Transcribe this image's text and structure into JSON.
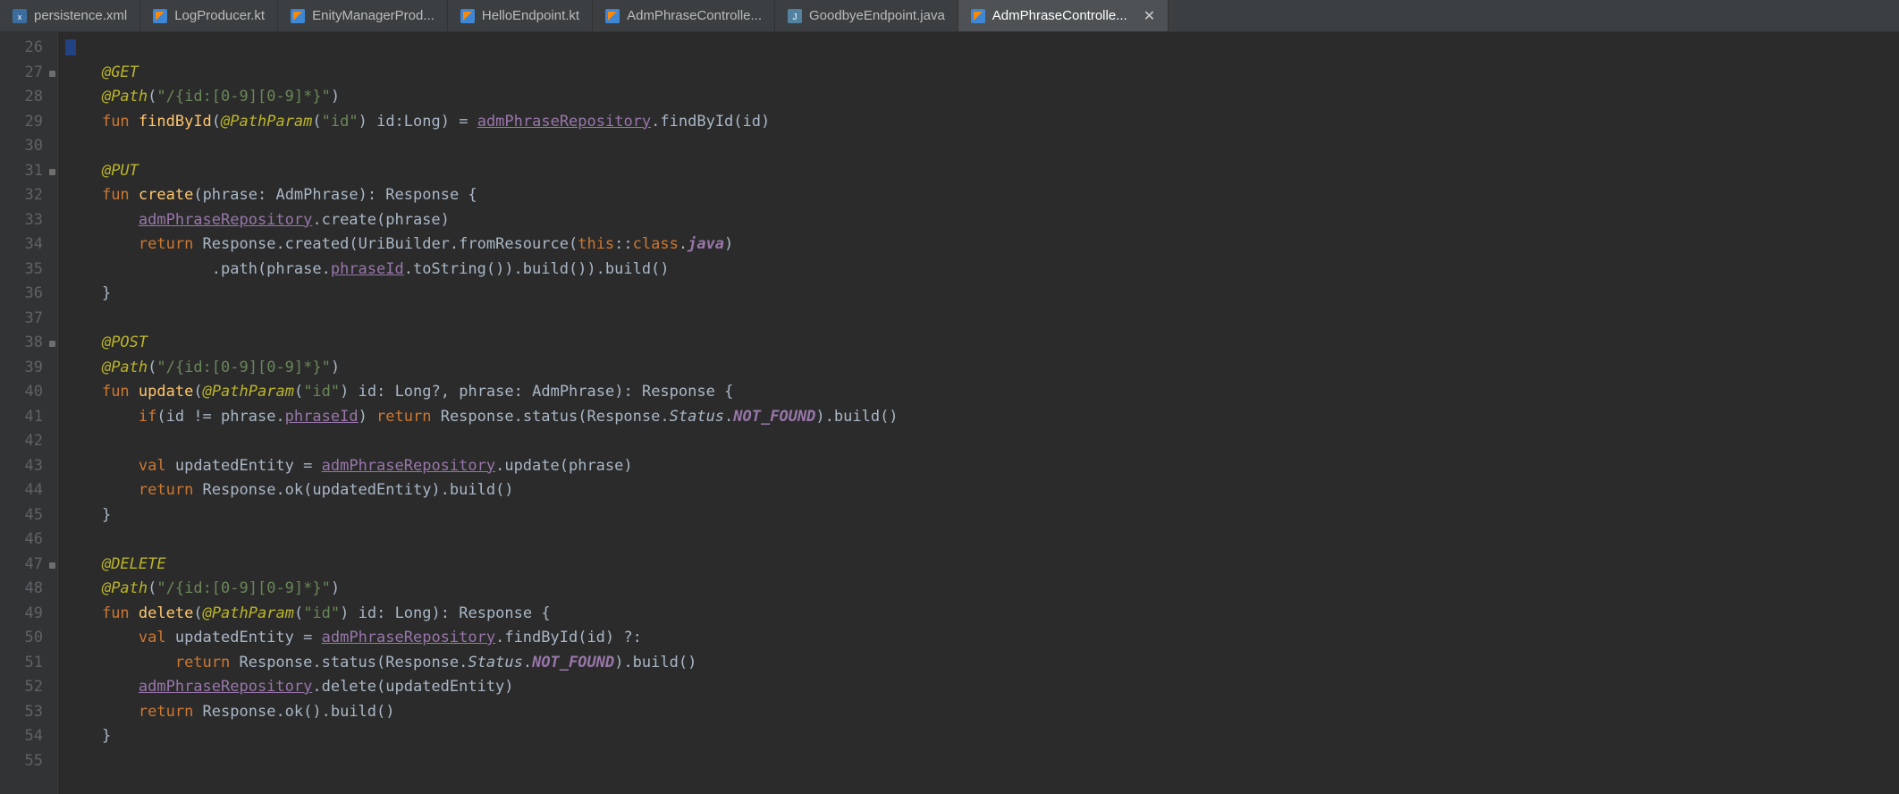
{
  "tabs": [
    {
      "label": "persistence.xml",
      "icon": "xml",
      "active": false,
      "close": false
    },
    {
      "label": "LogProducer.kt",
      "icon": "kt",
      "active": false,
      "close": false
    },
    {
      "label": "EnityManagerProd...",
      "icon": "kt",
      "active": false,
      "close": false
    },
    {
      "label": "HelloEndpoint.kt",
      "icon": "kt",
      "active": false,
      "close": false
    },
    {
      "label": "AdmPhraseControlle...",
      "icon": "kt",
      "active": false,
      "close": false
    },
    {
      "label": "GoodbyeEndpoint.java",
      "icon": "java",
      "active": false,
      "close": false
    },
    {
      "label": "AdmPhraseControlle...",
      "icon": "kt",
      "active": true,
      "close": true
    }
  ],
  "lines": {
    "start": 26,
    "end": 55,
    "folds": [
      27,
      31,
      38,
      47
    ]
  },
  "code": {
    "l27": {
      "anno": "@GET"
    },
    "l28": {
      "anno": "@Path",
      "p1": "(",
      "str": "\"/{id:[0-9][0-9]*}\"",
      "p2": ")"
    },
    "l29": {
      "kw1": "fun ",
      "fn": "findById",
      "p1": "(",
      "anno": "@PathParam",
      "p2": "(",
      "str": "\"id\"",
      "p3": ") id:",
      "type": "Long",
      "p4": ") = ",
      "repo": "admPhraseRepository",
      "p5": ".findById(id)"
    },
    "l31": {
      "anno": "@PUT"
    },
    "l32": {
      "kw1": "fun ",
      "fn": "create",
      "p1": "(phrase: ",
      "type": "AdmPhrase",
      "p2": "): ",
      "type2": "Response",
      "p3": " {"
    },
    "l33": {
      "repo": "admPhraseRepository",
      "p1": ".create(phrase)"
    },
    "l34": {
      "kw1": "return ",
      "cls": "Response",
      "p1": ".created(",
      "cls2": "UriBuilder",
      "p2": ".fromResource(",
      "kw2": "this",
      "p3": "::",
      "kw3": "class",
      "p4": ".",
      "jf": "java",
      "p5": ")"
    },
    "l35": {
      "p1": ".path(phrase.",
      "id": "phraseId",
      "p2": ".toString()).build()).build()"
    },
    "l36": {
      "p1": "}"
    },
    "l38": {
      "anno": "@POST"
    },
    "l39": {
      "anno": "@Path",
      "p1": "(",
      "str": "\"/{id:[0-9][0-9]*}\"",
      "p2": ")"
    },
    "l40": {
      "kw1": "fun ",
      "fn": "update",
      "p1": "(",
      "anno": "@PathParam",
      "p2": "(",
      "str": "\"id\"",
      "p3": ") id: ",
      "type": "Long?",
      "p4": ", phrase: ",
      "type2": "AdmPhrase",
      "p5": "): ",
      "type3": "Response",
      "p6": " {"
    },
    "l41": {
      "kw1": "if",
      "p1": "(id != phrase.",
      "id": "phraseId",
      "p2": ") ",
      "kw2": "return ",
      "cls": "Response",
      "p3": ".status(",
      "cls2": "Response",
      "p4": ".",
      "st": "Status",
      "p5": ".",
      "nf": "NOT_FOUND",
      "p6": ").build()"
    },
    "l43": {
      "kw1": "val ",
      "var": "updatedEntity",
      "p1": " = ",
      "repo": "admPhraseRepository",
      "p2": ".update(phrase)"
    },
    "l44": {
      "kw1": "return ",
      "cls": "Response",
      "p1": ".ok(updatedEntity).build()"
    },
    "l45": {
      "p1": "}"
    },
    "l47": {
      "anno": "@DELETE"
    },
    "l48": {
      "anno": "@Path",
      "p1": "(",
      "str": "\"/{id:[0-9][0-9]*}\"",
      "p2": ")"
    },
    "l49": {
      "kw1": "fun ",
      "fn": "delete",
      "p1": "(",
      "anno": "@PathParam",
      "p2": "(",
      "str": "\"id\"",
      "p3": ") id: ",
      "type": "Long",
      "p4": "): ",
      "type2": "Response",
      "p5": " {"
    },
    "l50": {
      "kw1": "val ",
      "var": "updatedEntity",
      "p1": " = ",
      "repo": "admPhraseRepository",
      "p2": ".findById(id) ?:"
    },
    "l51": {
      "kw1": "return ",
      "cls": "Response",
      "p1": ".status(",
      "cls2": "Response",
      "p2": ".",
      "st": "Status",
      "p3": ".",
      "nf": "NOT_FOUND",
      "p4": ").build()"
    },
    "l52": {
      "repo": "admPhraseRepository",
      "p1": ".delete(updatedEntity)"
    },
    "l53": {
      "kw1": "return ",
      "cls": "Response",
      "p1": ".ok().build()"
    },
    "l54": {
      "p1": "}"
    }
  }
}
